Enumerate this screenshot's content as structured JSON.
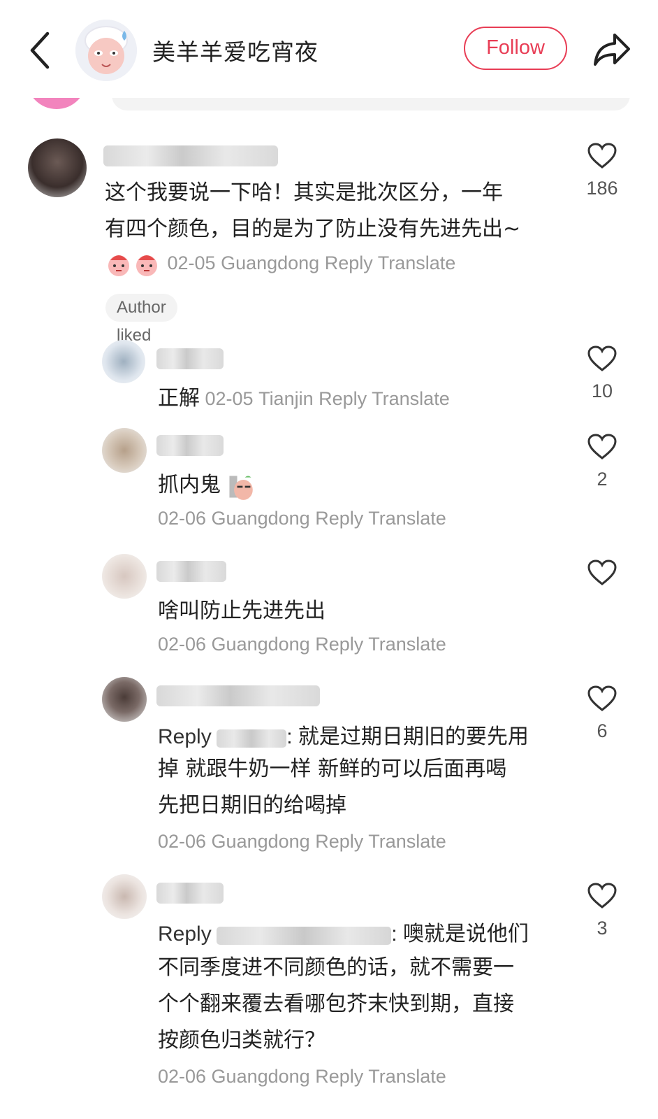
{
  "header": {
    "title": "美羊羊爱吃宵夜",
    "follow_label": "Follow"
  },
  "main_comment": {
    "text_line1": "这个我要说一下哈！其实是批次区分，一年",
    "text_line2": "有四个颜色，目的是为了防止没有先进先出~",
    "date_location": "02-05 Guangdong",
    "reply_label": "Reply",
    "translate_label": "Translate",
    "likes": "186",
    "author_liked": "Author liked"
  },
  "replies": [
    {
      "text": "正解",
      "date_location": "02-05 Tianjin",
      "reply_label": "Reply",
      "translate_label": "Translate",
      "likes": "10"
    },
    {
      "text": "抓内鬼",
      "date_location": "02-06 Guangdong",
      "reply_label": "Reply",
      "translate_label": "Translate",
      "likes": "2"
    },
    {
      "text": "啥叫防止先进先出",
      "date_location": "02-06 Guangdong",
      "reply_label": "Reply",
      "translate_label": "Translate",
      "likes": ""
    },
    {
      "reply_prefix": "Reply",
      "text_line1": ": 就是过期日期旧的要先用",
      "text_line2": "掉 就跟牛奶一样 新鲜的可以后面再喝",
      "text_line3": "先把日期旧的给喝掉",
      "date_location": "02-06 Guangdong",
      "reply_label": "Reply",
      "translate_label": "Translate",
      "likes": "6"
    },
    {
      "reply_prefix": "Reply",
      "text_line1": ": 噢就是说他们",
      "text_line2": "不同季度进不同颜色的话，就不需要一",
      "text_line3": "个个翻来覆去看哪包芥末快到期，直接",
      "text_line4": "按颜色归类就行？",
      "date_location": "02-06 Guangdong",
      "reply_label": "Reply",
      "translate_label": "Translate",
      "likes": "3"
    }
  ],
  "colors": {
    "accent": "#e83d55",
    "translate": "#1f3e6e",
    "meta": "#999999"
  }
}
